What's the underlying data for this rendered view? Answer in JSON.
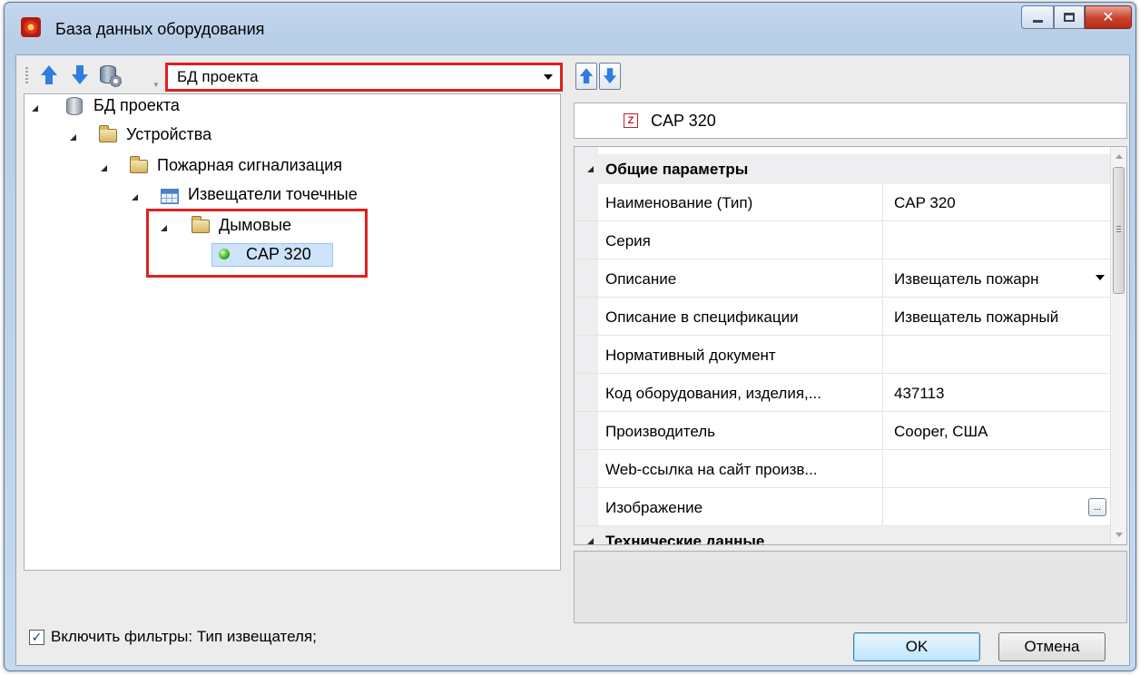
{
  "window": {
    "title": "База данных оборудования"
  },
  "left": {
    "database_select": {
      "value": "БД проекта"
    },
    "tree": [
      {
        "label": "БД проекта",
        "icon": "database-icon"
      },
      {
        "label": "Устройства",
        "icon": "folder-icon"
      },
      {
        "label": "Пожарная сигнализация",
        "icon": "folder-icon"
      },
      {
        "label": "Извещатели точечные",
        "icon": "table-icon"
      },
      {
        "label": "Дымовые",
        "icon": "folder-icon"
      },
      {
        "label": "CAP 320",
        "icon": "green-dot-icon"
      }
    ],
    "filter": {
      "checked": true,
      "label": "Включить фильтры: Тип извещателя;"
    }
  },
  "right": {
    "selected_item": "CAP 320",
    "categories": [
      {
        "title": "Общие параметры",
        "rows": [
          {
            "name": "Наименование (Тип)",
            "value": "CAP 320"
          },
          {
            "name": "Серия",
            "value": ""
          },
          {
            "name": "Описание",
            "value": "Извещатель пожарн"
          },
          {
            "name": "Описание в спецификации",
            "value": "Извещатель пожарный"
          },
          {
            "name": "Нормативный документ",
            "value": ""
          },
          {
            "name": "Код оборудования, изделия,...",
            "value": "437113"
          },
          {
            "name": "Производитель",
            "value": "Cooper, США"
          },
          {
            "name": "Web-ссылка на сайт произв...",
            "value": ""
          },
          {
            "name": "Изображение",
            "value": ""
          }
        ]
      },
      {
        "title": "Технические данные",
        "rows": []
      }
    ],
    "ellipsis_label": "..."
  },
  "buttons": {
    "ok": "OK",
    "cancel": "Отмена"
  },
  "colors": {
    "highlight_border": "#e02020",
    "selection": "#cde3f9",
    "title_bar": "#c3d7ee"
  }
}
